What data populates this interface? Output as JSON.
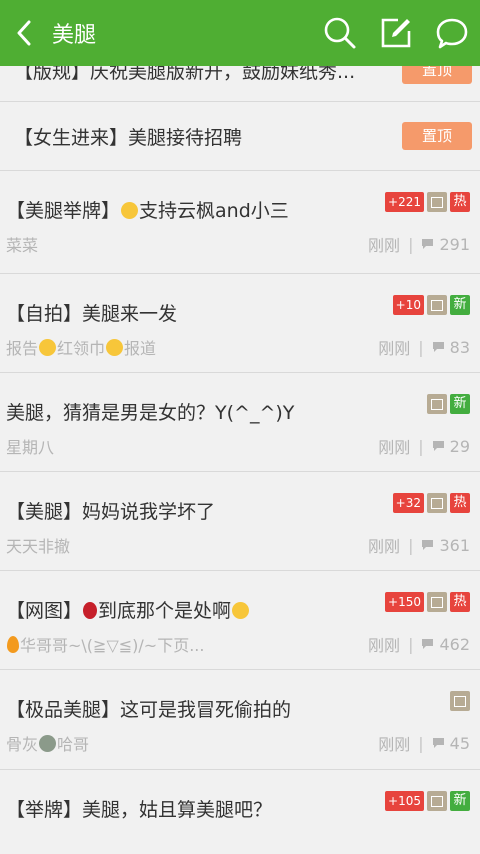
{
  "header": {
    "title": "美腿",
    "accent": "#4fae33"
  },
  "partial_row": {
    "title": "【版规】庆祝美腿版新开，鼓励妹纸秀...",
    "tag": "置顶"
  },
  "pinned": {
    "title": "【女生进来】美腿接待招聘",
    "tag": "置顶"
  },
  "posts": [
    {
      "title": "【美腿举牌】",
      "emoji_icon": "laughing-face",
      "title_rest": "支持云枫and小三",
      "author": "菜菜",
      "time": "刚刚",
      "comments": "291",
      "count_badge": "+221",
      "status_badge": "热"
    },
    {
      "title": "【自拍】美腿来一发",
      "author": "报告",
      "author_emoji": "smile",
      "author_mid": "红领巾",
      "author_emoji2": "smile",
      "author_rest": "报道",
      "time": "刚刚",
      "comments": "83",
      "count_badge": "+10",
      "status_badge": "新"
    },
    {
      "title": "美腿，猜猜是男是女的？Y(^_^)Y",
      "author": "星期八",
      "time": "刚刚",
      "comments": "29",
      "status_badge": "新"
    },
    {
      "title": "【美腿】妈妈说我学坏了",
      "author": "天天非撤",
      "time": "刚刚",
      "comments": "361",
      "count_badge": "+32",
      "status_badge": "热"
    },
    {
      "title": "【网图】",
      "emoji_icon": "rose",
      "title_rest": "到底那个是处啊",
      "emoji_icon2": "laughing-face",
      "author_emoji": "fire",
      "author": "华哥哥~\\(≧▽≦)/~下页...",
      "time": "刚刚",
      "comments": "462",
      "count_badge": "+150",
      "status_badge": "热"
    },
    {
      "title": "【极品美腿】这可是我冒死偷拍的",
      "author": "骨灰",
      "author_emoji": "alien",
      "author_rest": "哈哥",
      "time": "刚刚",
      "comments": "45"
    },
    {
      "title": "【举牌】美腿，姑且算美腿吧？",
      "count_badge": "+105",
      "status_badge": "新"
    }
  ]
}
